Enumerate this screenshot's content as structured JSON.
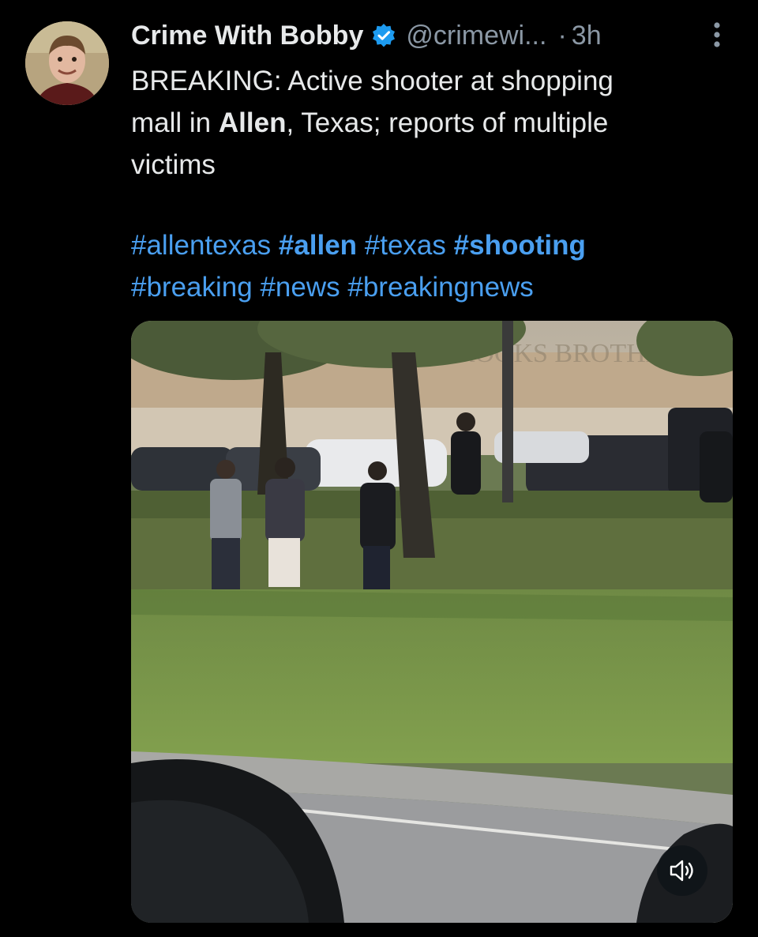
{
  "tweet": {
    "author": {
      "display_name": "Crime With Bobby",
      "handle": "@crimewi...",
      "verified": true,
      "avatar": "user-avatar-photo"
    },
    "separator": "·",
    "timestamp": "3h",
    "more_icon": "more-options-icon",
    "text_lines": [
      {
        "pre": "BREAKING: Active shooter at shopping",
        "bold": "",
        "post": ""
      },
      {
        "pre": "mall in ",
        "bold": "Allen",
        "post": ", Texas; reports of multiple"
      },
      {
        "pre": "victims",
        "bold": "",
        "post": ""
      }
    ],
    "hashtags_line1": [
      "#allentexas",
      "#allen",
      "#texas",
      "#shooting"
    ],
    "hashtags_line2": [
      "#breaking",
      "#news",
      "#breakingnews"
    ],
    "media": {
      "type": "video",
      "mute_icon": "speaker-muted-icon"
    }
  },
  "colors": {
    "background": "#000000",
    "text": "#e7e9ea",
    "secondary": "#8b98a5",
    "link": "#4a9ff0",
    "verified_badge": "#1d9bf0"
  }
}
